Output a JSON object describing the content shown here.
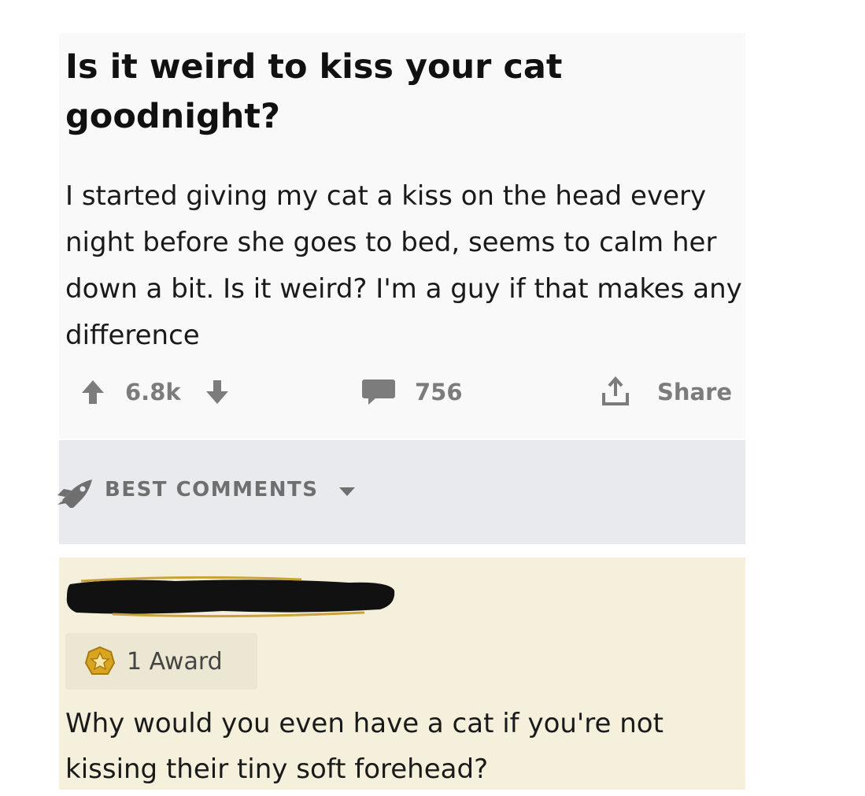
{
  "post": {
    "title": "Is it weird to kiss your cat goodnight?",
    "body": "I started giving my cat a kiss on the head every night before she goes to bed, seems to calm her down a bit. Is it weird? I'm a guy if that makes any difference",
    "vote_count": "6.8k",
    "comment_count": "756",
    "share_label": "Share"
  },
  "sort": {
    "label": "BEST COMMENTS"
  },
  "comment": {
    "award_label": "1 Award",
    "body": "Why would you even have a cat if you're not kissing their tiny soft forehead?"
  },
  "colors": {
    "post_background": "#f9f9f9",
    "sort_bar_background": "#e9eaed",
    "comment_background": "#f5f0dc",
    "award_background": "#ece7d3",
    "action_icon": "#7c7c7c",
    "award_gold": "#d9a520"
  },
  "icons": [
    "upvote-arrow-icon",
    "downvote-arrow-icon",
    "comment-bubble-icon",
    "share-icon",
    "rocket-icon",
    "caret-down-icon",
    "award-icon"
  ]
}
